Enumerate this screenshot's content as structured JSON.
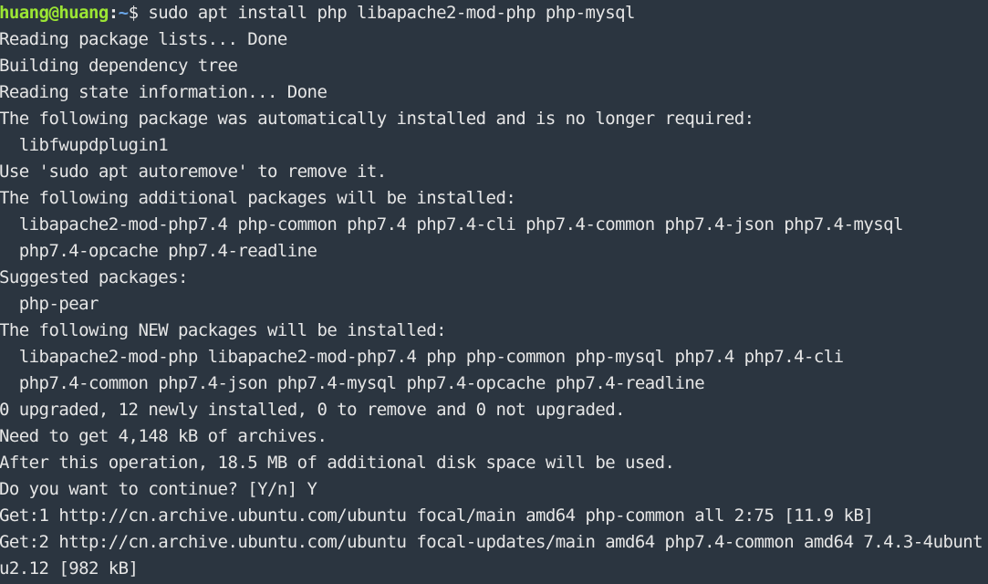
{
  "prompt": {
    "user_host": "huang@huang",
    "separator": ":",
    "path": "~",
    "symbol": "$ ",
    "command": "sudo apt install php libapache2-mod-php php-mysql"
  },
  "output_lines": [
    "Reading package lists... Done",
    "Building dependency tree",
    "Reading state information... Done",
    "The following package was automatically installed and is no longer required:",
    "  libfwupdplugin1",
    "Use 'sudo apt autoremove' to remove it.",
    "The following additional packages will be installed:",
    "  libapache2-mod-php7.4 php-common php7.4 php7.4-cli php7.4-common php7.4-json php7.4-mysql",
    "  php7.4-opcache php7.4-readline",
    "Suggested packages:",
    "  php-pear",
    "The following NEW packages will be installed:",
    "  libapache2-mod-php libapache2-mod-php7.4 php php-common php-mysql php7.4 php7.4-cli",
    "  php7.4-common php7.4-json php7.4-mysql php7.4-opcache php7.4-readline",
    "0 upgraded, 12 newly installed, 0 to remove and 0 not upgraded.",
    "Need to get 4,148 kB of archives.",
    "After this operation, 18.5 MB of additional disk space will be used.",
    "Do you want to continue? [Y/n] Y",
    "Get:1 http://cn.archive.ubuntu.com/ubuntu focal/main amd64 php-common all 2:75 [11.9 kB]",
    "Get:2 http://cn.archive.ubuntu.com/ubuntu focal-updates/main amd64 php7.4-common amd64 7.4.3-4ubunt",
    "u2.12 [982 kB]"
  ],
  "colors": {
    "background": "#2b3540",
    "text": "#e6e6e6",
    "user_host": "#9ce634",
    "path": "#6aa6e8"
  }
}
